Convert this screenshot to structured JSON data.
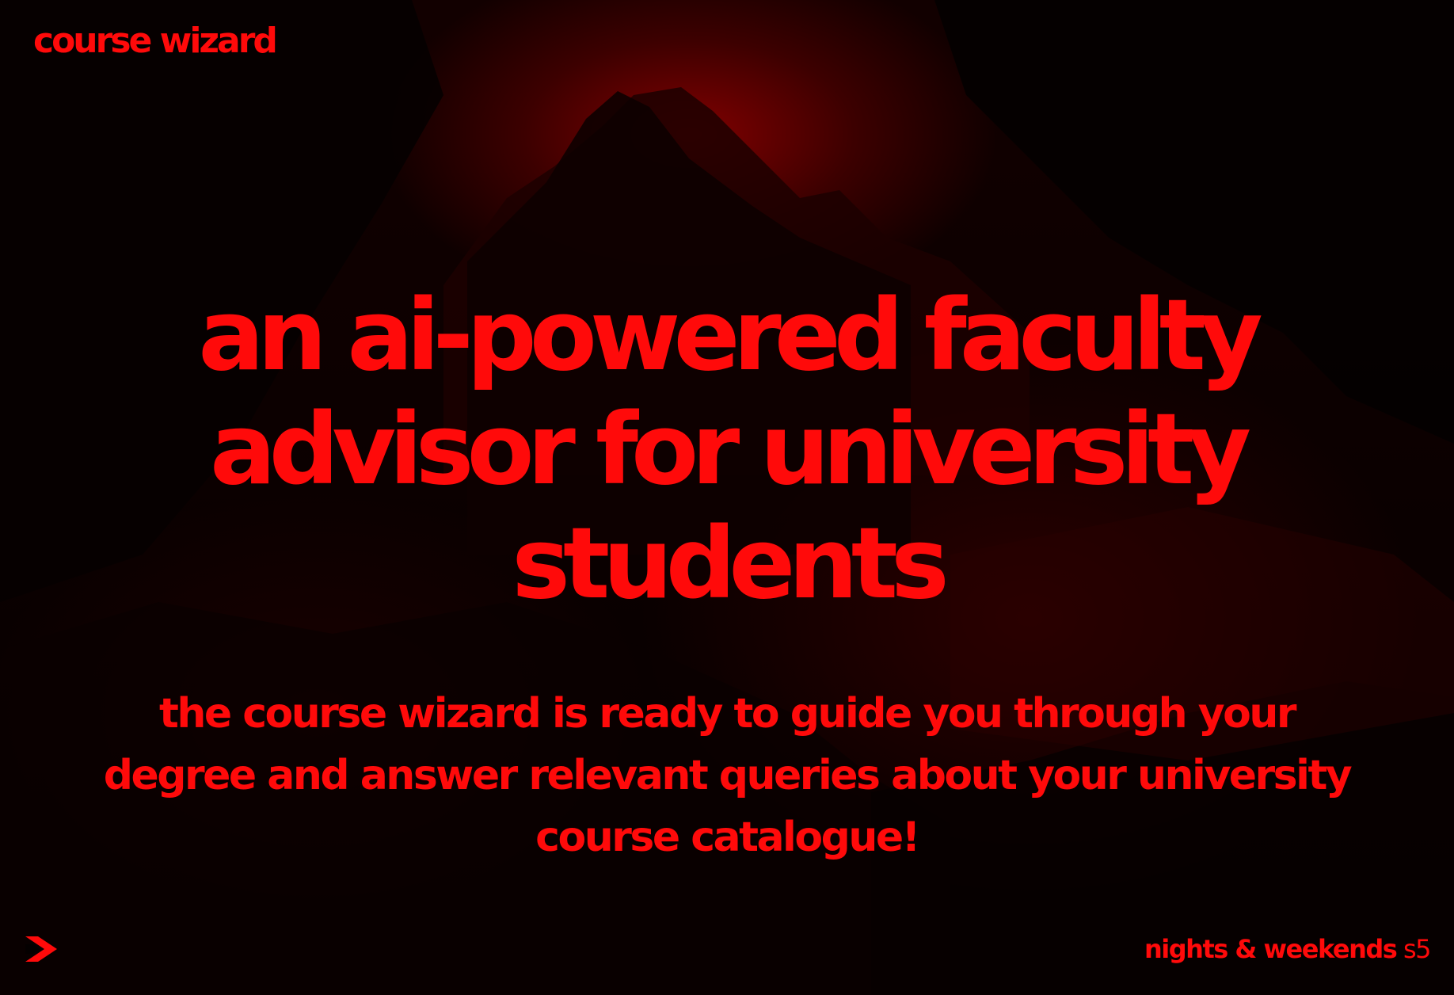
{
  "brand": {
    "name": "course wizard"
  },
  "hero": {
    "headline": "an ai-powered faculty advisor for university students",
    "tagline": "the course wizard is ready to guide you through your degree and answer relevant queries about your university course catalogue!"
  },
  "footer": {
    "program": "nights & weekends",
    "season": "s5"
  },
  "icons": {
    "logo": "arrow-stack-logo-icon"
  },
  "colors": {
    "accent": "#ff0a0a",
    "background": "#000000",
    "glow": "#960000"
  }
}
